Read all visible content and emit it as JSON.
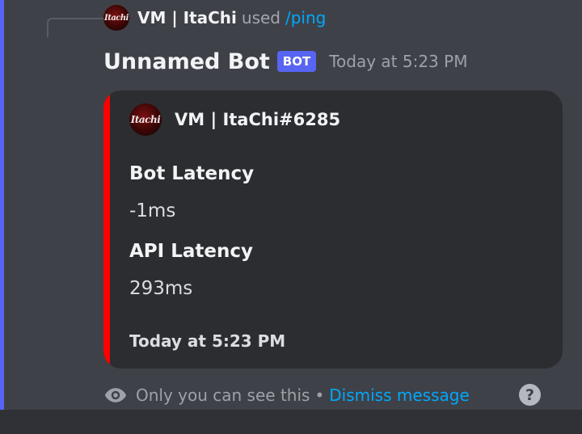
{
  "reply": {
    "avatar_text": "Itachi",
    "username": "VM | ItaChi",
    "used_text": "used",
    "command": "/ping"
  },
  "message": {
    "bot_name": "Unnamed Bot",
    "bot_tag": "BOT",
    "timestamp": "Today at 5:23 PM"
  },
  "embed": {
    "color": "#ff0000",
    "author_avatar_text": "Itachi",
    "author": "VM | ItaChi#6285",
    "fields": [
      {
        "name": "Bot Latency",
        "value": "-1ms"
      },
      {
        "name": "API Latency",
        "value": "293ms"
      }
    ],
    "footer": "Today at 5:23 PM"
  },
  "ephemeral": {
    "icon": "eye-icon",
    "text": "Only you can see this",
    "separator": "•",
    "dismiss_label": "Dismiss message"
  },
  "help_icon": "?",
  "colors": {
    "accent": "#5865f2",
    "link": "#00a8fc",
    "embed_bar": "#ff0000"
  }
}
